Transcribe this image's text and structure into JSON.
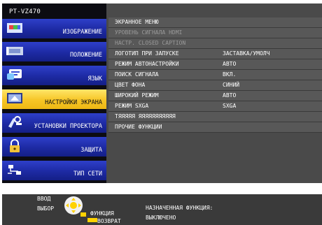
{
  "model": "PT-VZ470",
  "menu": [
    {
      "label": "ИЗОБРАЖЕНИЕ",
      "icon": "picture-icon",
      "active": false
    },
    {
      "label": "ПОЛОЖЕНИЕ",
      "icon": "position-icon",
      "active": false
    },
    {
      "label": "ЯЗЫК",
      "icon": "language-icon",
      "active": false
    },
    {
      "label": "НАСТРОЙКИ ЭКРАНА",
      "icon": "display-settings-icon",
      "active": true
    },
    {
      "label": "УСТАНОВКИ ПРОЕКТОРА",
      "icon": "projector-setup-icon",
      "active": false
    },
    {
      "label": "ЗАЩИТА",
      "icon": "lock-icon",
      "active": false
    },
    {
      "label": "ТИП СЕТИ",
      "icon": "network-icon",
      "active": false
    }
  ],
  "rows": [
    {
      "label": "ЭКРАННОЕ МЕНЮ",
      "value": "",
      "disabled": false
    },
    {
      "label": "УРОВЕНЬ СИГНАЛА HDMI",
      "value": "",
      "disabled": true
    },
    {
      "label": "НАСТР. CLOSED CAPTION",
      "value": "",
      "disabled": true
    },
    {
      "label": "ЛОГОТИП ПРИ ЗАПУСКЕ",
      "value": "ЗАСТАВКА/УМОЛЧ",
      "disabled": false
    },
    {
      "label": "РЕЖИМ АВТОНАСТРОЙКИ",
      "value": "АВТО",
      "disabled": false
    },
    {
      "label": "ПОИСК СИГНАЛА",
      "value": "ВКЛ.",
      "disabled": false
    },
    {
      "label": "ЦВЕТ ФОНА",
      "value": "СИНИЙ",
      "disabled": false
    },
    {
      "label": "ШИРОКИЙ РЕЖИМ",
      "value": "АВТО",
      "disabled": false
    },
    {
      "label": "РЕЖИМ SXGA",
      "value": "SXGA",
      "disabled": false
    },
    {
      "label": "ТЯЯЯЯЯ ЯЯЯЯЯЯЯЯЯЯЯ",
      "value": "",
      "disabled": false
    },
    {
      "label": "ПРОЧИЕ ФУНКЦИИ",
      "value": "",
      "disabled": false
    }
  ],
  "footer": {
    "enter": "ВВОД",
    "select": "ВЫБОР",
    "function": "ФУНКЦИЯ",
    "return": "ВОЗВРАТ",
    "assigned_function_label": "НАЗНАЧЕННАЯ ФУНКЦИЯ:",
    "assigned_function_value": "ВЫКЛЮЧЕНО"
  },
  "colors": {
    "menu_blue": "#1d2aa3",
    "menu_active_yellow": "#f6c526",
    "panel_gray": "#585858",
    "frame_black": "#0c0c12"
  }
}
